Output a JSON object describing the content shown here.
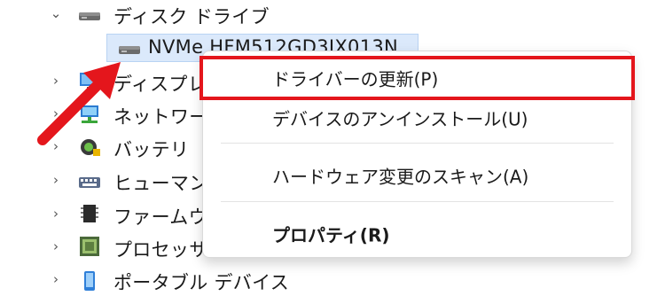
{
  "tree": {
    "disk_drives": {
      "label": "ディスク ドライブ",
      "icon": "drive-icon"
    },
    "nvme_device": {
      "label": "NVMe HFM512GD3JX013N",
      "icon": "drive-icon"
    },
    "items": [
      {
        "label": "ディスプレイ",
        "icon": "display-adapter-icon"
      },
      {
        "label": "ネットワーク",
        "icon": "network-icon"
      },
      {
        "label": "バッテリ",
        "icon": "battery-icon"
      },
      {
        "label": "ヒューマン",
        "icon": "hid-icon"
      },
      {
        "label": "ファームウェ",
        "icon": "firmware-icon"
      },
      {
        "label": "プロセッサ",
        "icon": "processor-icon"
      },
      {
        "label": "ポータブル デバイス",
        "icon": "portable-device-icon"
      }
    ]
  },
  "context_menu": {
    "update_driver": "ドライバーの更新(P)",
    "uninstall_device": "デバイスのアンインストール(U)",
    "scan_hardware": "ハードウェア変更のスキャン(A)",
    "properties": "プロパティ(R)"
  },
  "colors": {
    "highlight_border": "#e4161c",
    "arrow": "#e4161c",
    "selection": "#dbe9fb"
  }
}
